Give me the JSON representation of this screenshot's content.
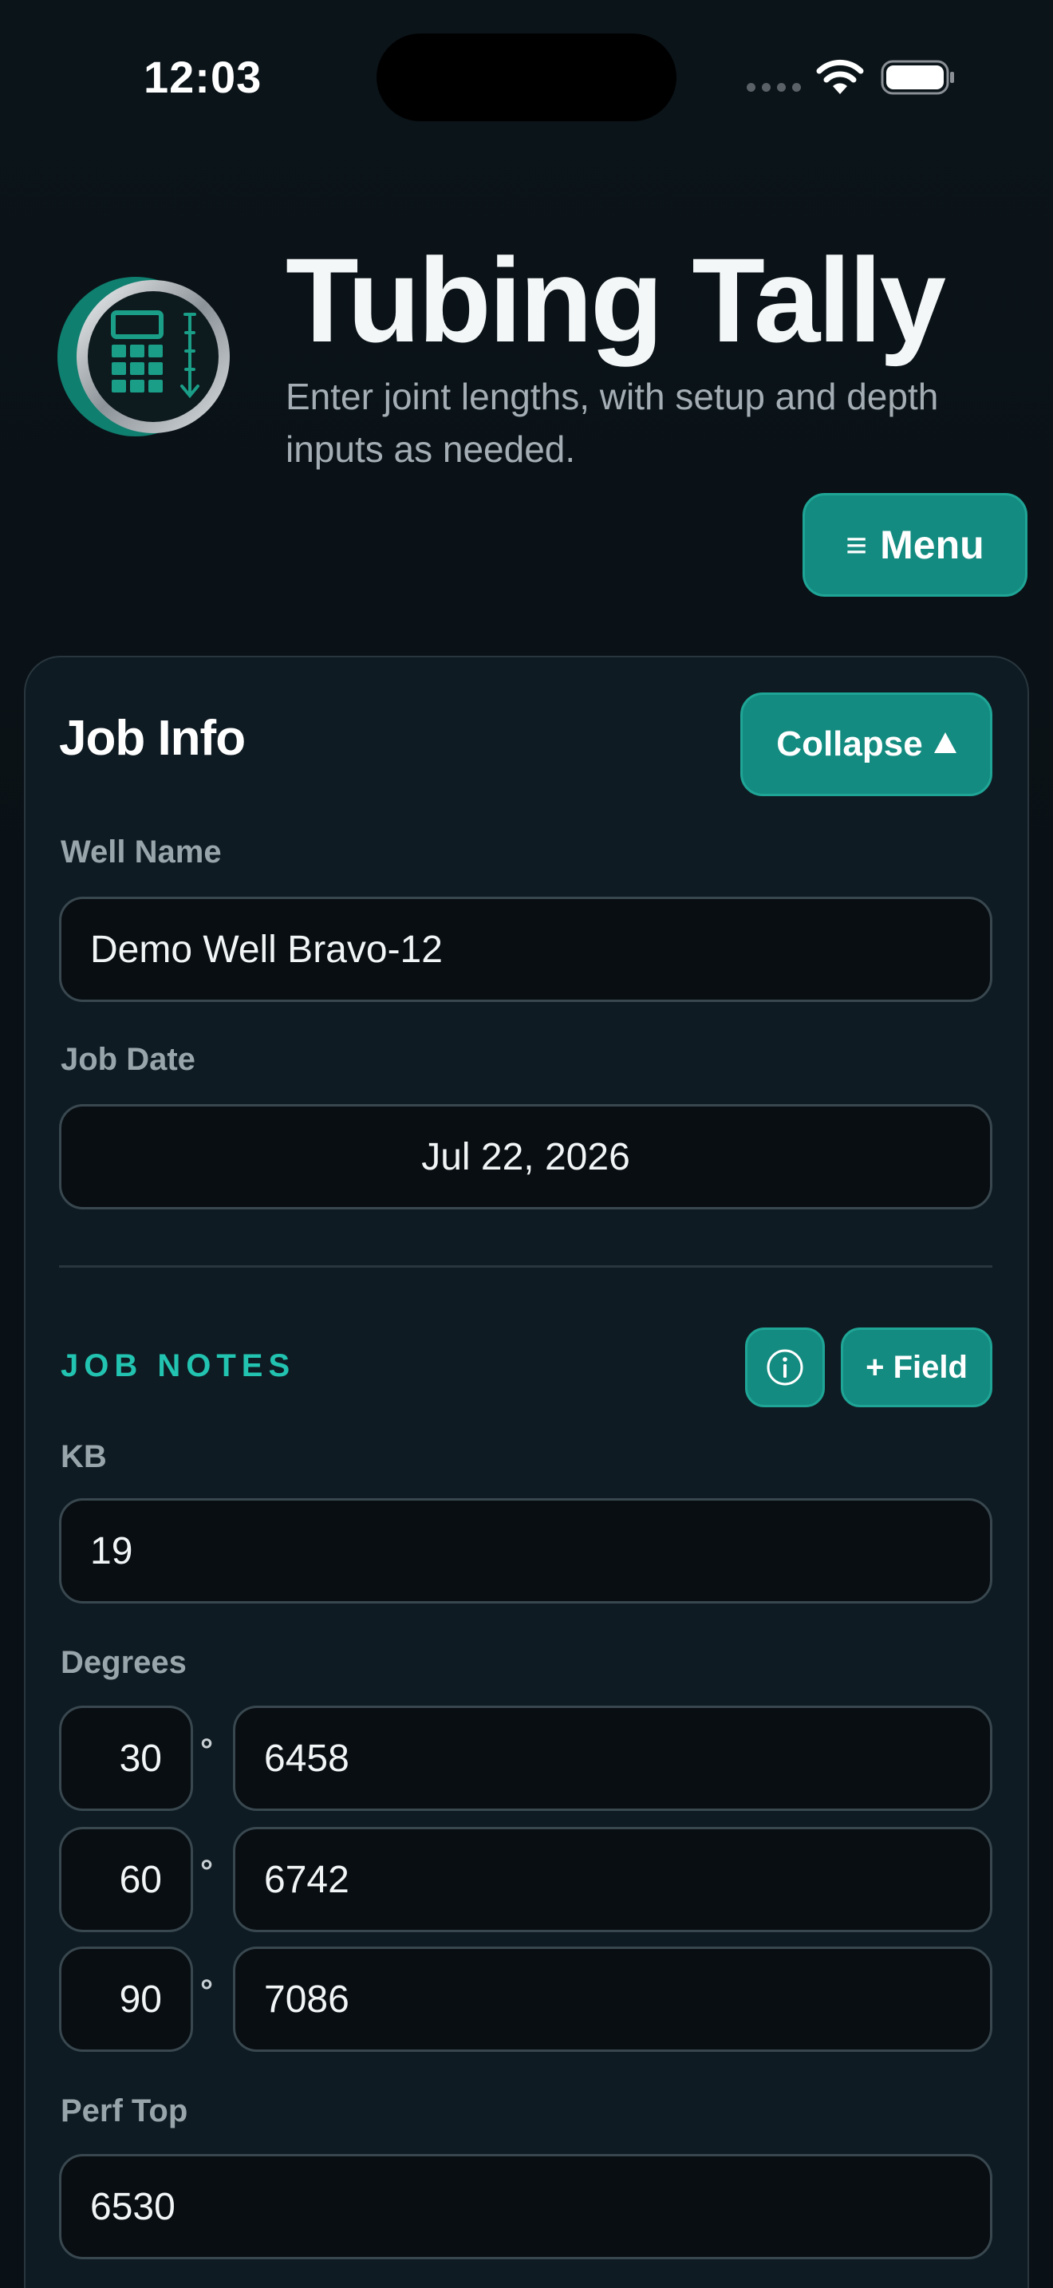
{
  "status_bar": {
    "time": "12:03"
  },
  "header": {
    "title": "Tubing Tally",
    "subtitle": "Enter joint lengths, with setup and depth inputs as needed.",
    "logo_icon": "calculator-depth-icon",
    "menu_glyph": "≡",
    "menu_label": "Menu"
  },
  "job_info": {
    "title": "Job Info",
    "collapse_label": "Collapse",
    "well_name_label": "Well Name",
    "well_name_value": "Demo Well Bravo-12",
    "job_date_label": "Job Date",
    "job_date_value": "Jul 22, 2026"
  },
  "job_notes": {
    "heading": "JOB NOTES",
    "add_field_label": "+ Field",
    "kb_label": "KB",
    "kb_value": "19",
    "degrees_label": "Degrees",
    "degree_symbol": "°",
    "degrees": [
      {
        "angle": "30",
        "depth": "6458"
      },
      {
        "angle": "60",
        "depth": "6742"
      },
      {
        "angle": "90",
        "depth": "7086"
      }
    ],
    "perf_top_label": "Perf Top",
    "perf_top_value": "6530"
  },
  "colors": {
    "accent": "#148b80",
    "accent_text": "#22c3b0",
    "background": "#0a1116",
    "card": "#0f1b22"
  }
}
